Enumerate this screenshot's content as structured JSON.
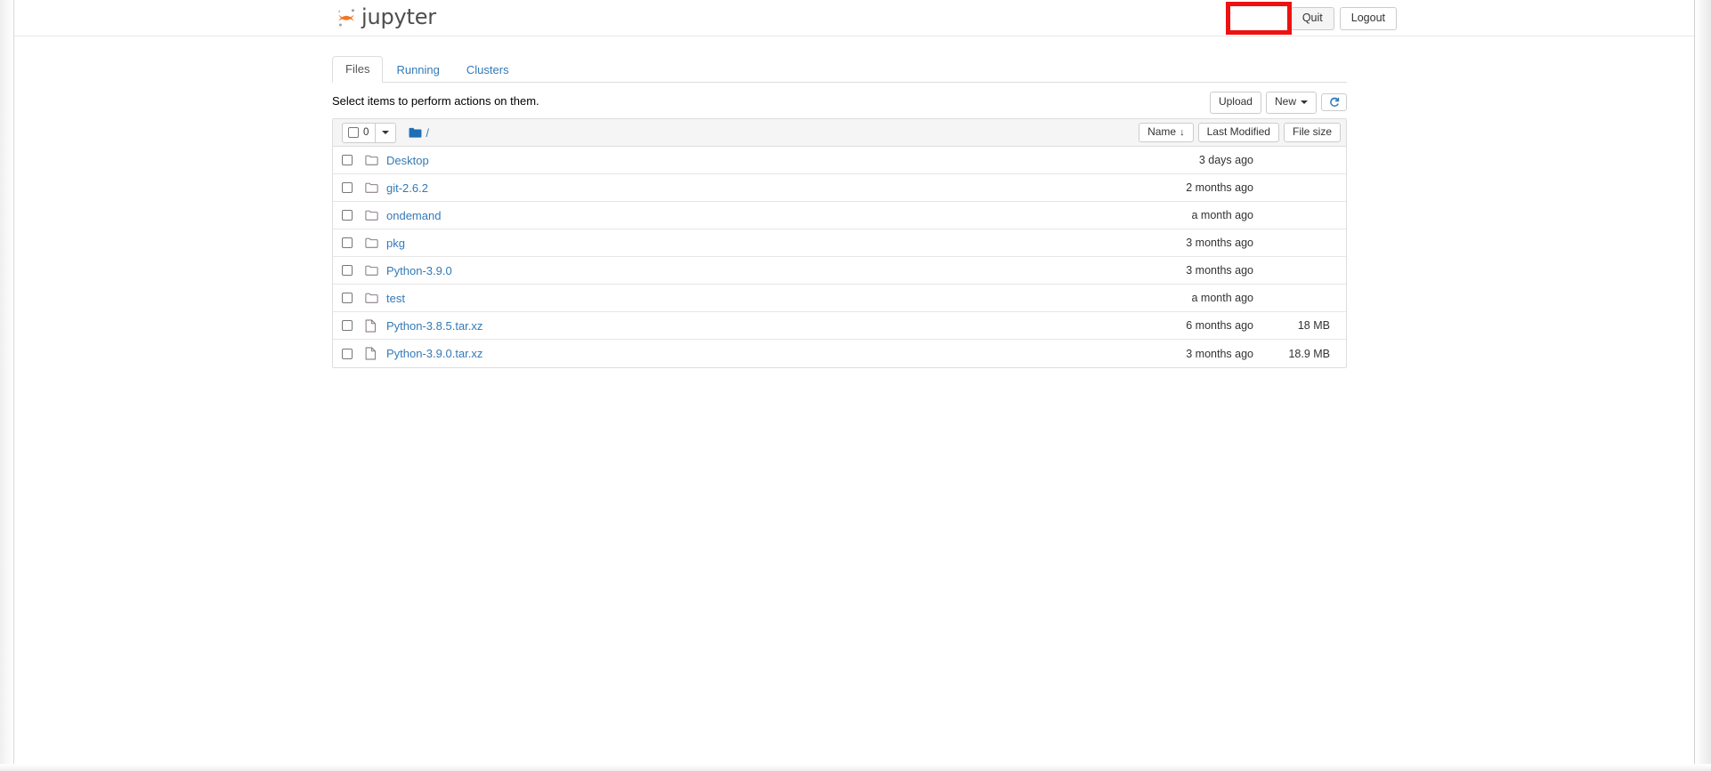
{
  "header": {
    "brand": "jupyter",
    "logo_icon": "jupyter-logo-icon",
    "quit_label": "Quit",
    "logout_label": "Logout",
    "highlight_color": "#ee1111",
    "highlighted_element": "Quit"
  },
  "tabs": [
    {
      "label": "Files",
      "active": true
    },
    {
      "label": "Running",
      "active": false
    },
    {
      "label": "Clusters",
      "active": false
    }
  ],
  "toolbar": {
    "hint": "Select items to perform actions on them.",
    "upload_label": "Upload",
    "new_label": "New",
    "new_caret_icon": "chevron-down-icon",
    "refresh_icon": "refresh-icon"
  },
  "list_header": {
    "selected_count": "0",
    "select_caret_icon": "chevron-down-icon",
    "folder_icon": "folder-filled-icon",
    "breadcrumb_path": "/",
    "sort_name_label": "Name",
    "sort_name_arrow": "↓",
    "sort_modified_label": "Last Modified",
    "sort_size_label": "File size"
  },
  "files": [
    {
      "name": "Desktop",
      "type": "folder",
      "icon": "folder-icon",
      "modified": "3 days ago",
      "size": ""
    },
    {
      "name": "git-2.6.2",
      "type": "folder",
      "icon": "folder-icon",
      "modified": "2 months ago",
      "size": ""
    },
    {
      "name": "ondemand",
      "type": "folder",
      "icon": "folder-icon",
      "modified": "a month ago",
      "size": ""
    },
    {
      "name": "pkg",
      "type": "folder",
      "icon": "folder-icon",
      "modified": "3 months ago",
      "size": ""
    },
    {
      "name": "Python-3.9.0",
      "type": "folder",
      "icon": "folder-icon",
      "modified": "3 months ago",
      "size": ""
    },
    {
      "name": "test",
      "type": "folder",
      "icon": "folder-icon",
      "modified": "a month ago",
      "size": ""
    },
    {
      "name": "Python-3.8.5.tar.xz",
      "type": "file",
      "icon": "file-icon",
      "modified": "6 months ago",
      "size": "18 MB"
    },
    {
      "name": "Python-3.9.0.tar.xz",
      "type": "file",
      "icon": "file-icon",
      "modified": "3 months ago",
      "size": "18.9 MB"
    }
  ],
  "colors": {
    "link": "#337ab7",
    "brand_orange": "#f37726",
    "toolbar_bg": "#f5f5f5",
    "border": "#dddddd"
  }
}
